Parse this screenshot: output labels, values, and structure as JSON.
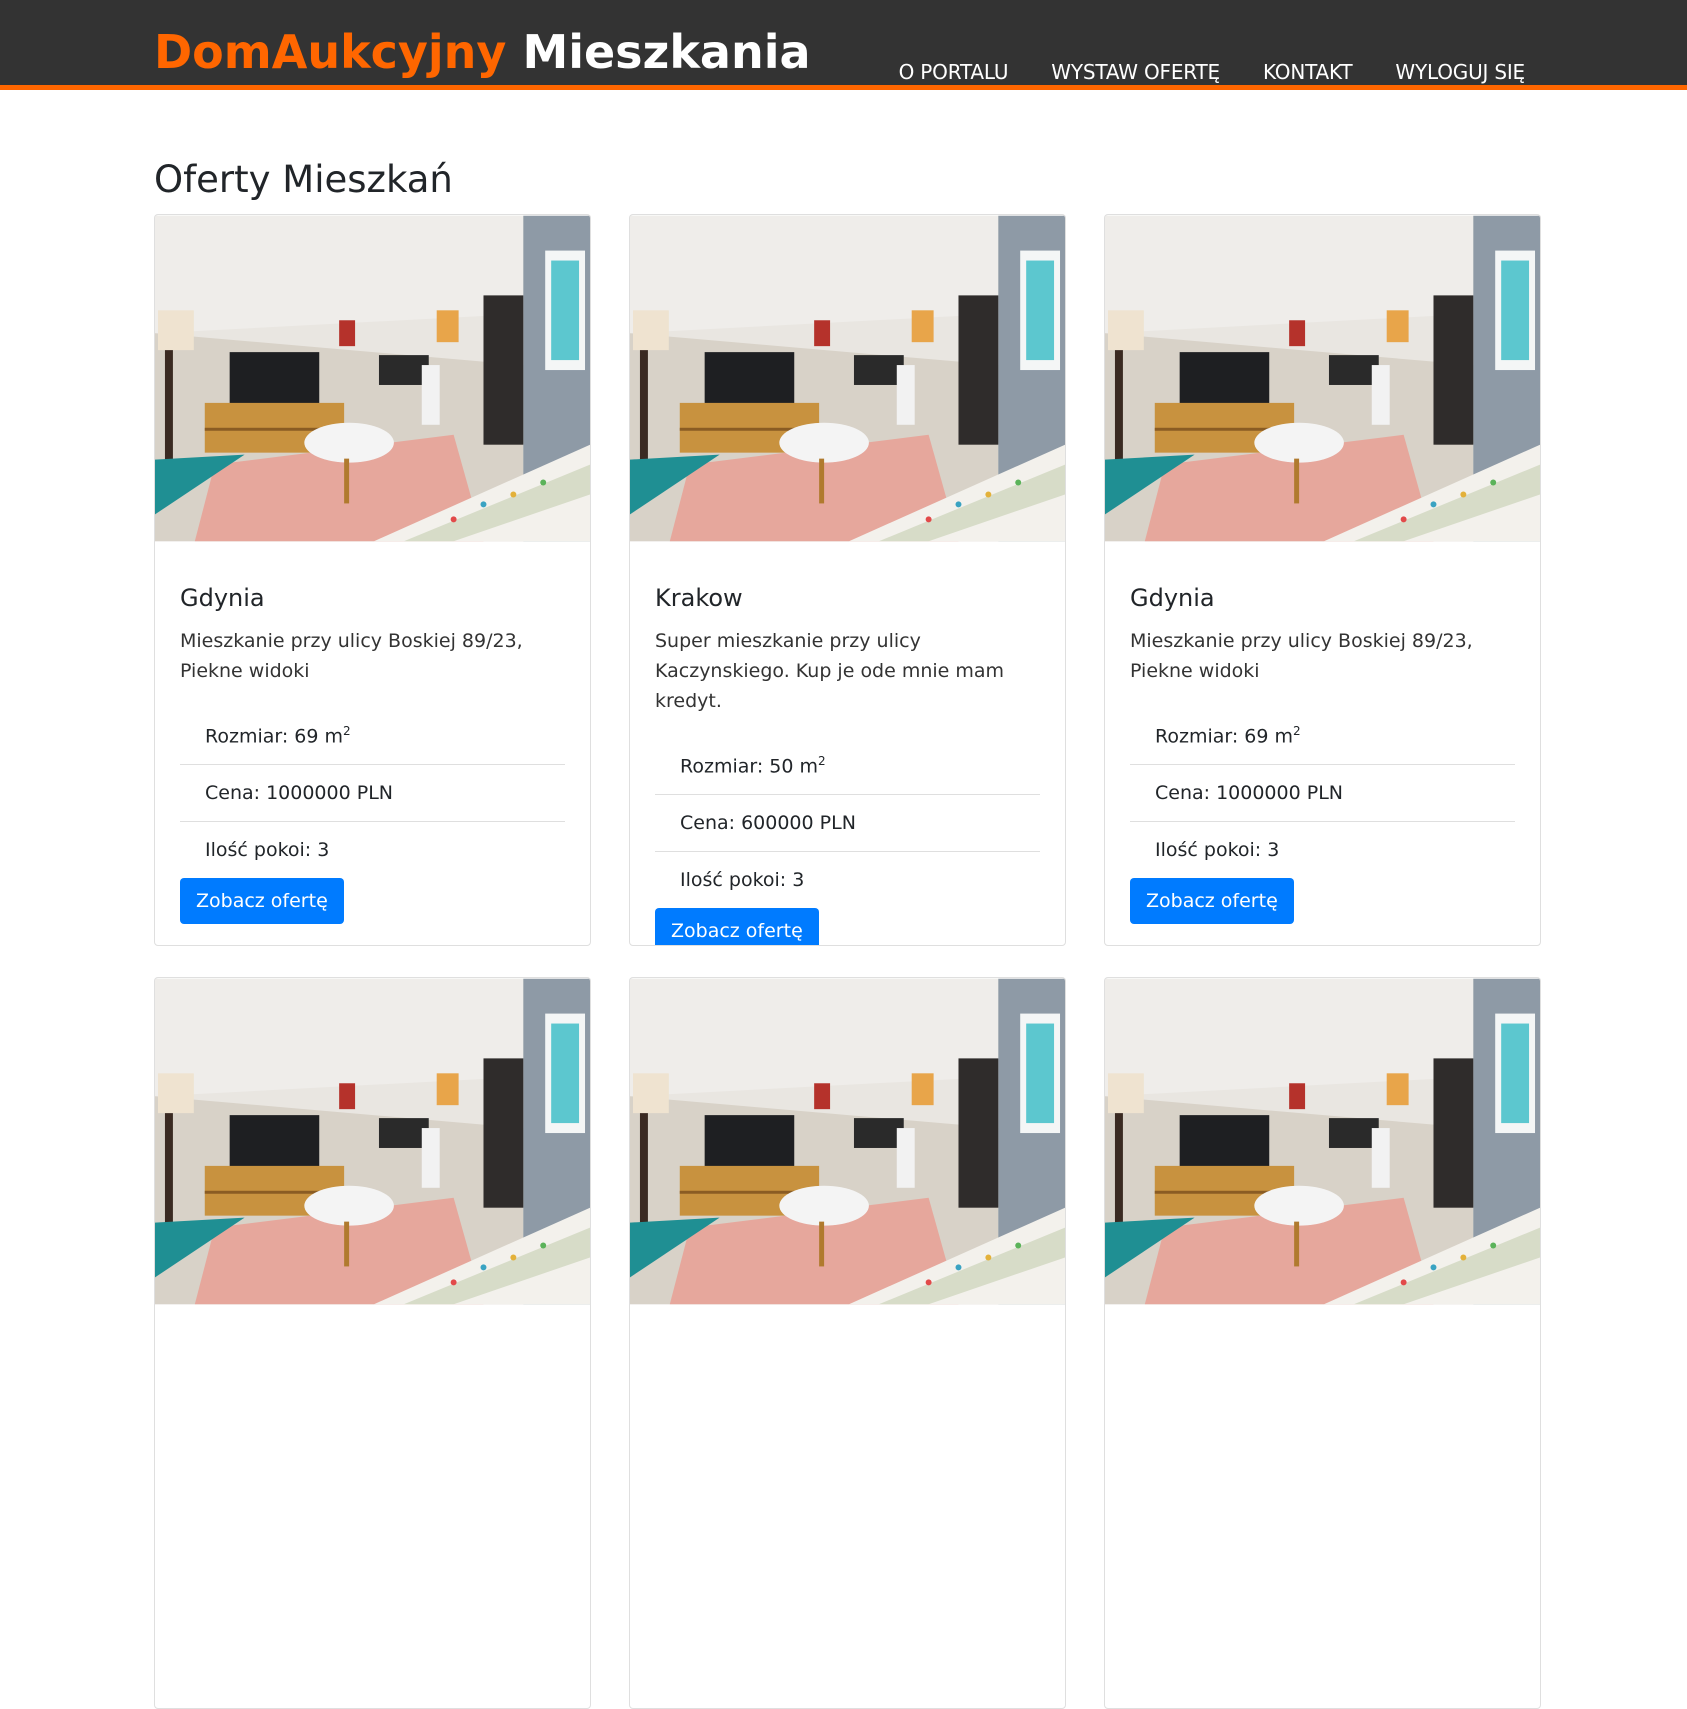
{
  "brand": {
    "part1": "DomAukcyjny",
    "part2": "Mieszkania",
    "accent_color": "#ff6600"
  },
  "nav": [
    {
      "label": "O PORTALU"
    },
    {
      "label": "WYSTAW OFERTĘ"
    },
    {
      "label": "KONTAKT"
    },
    {
      "label": "WYLOGUJ SIĘ"
    }
  ],
  "page_title": "Oferty Mieszkań",
  "labels": {
    "size": "Rozmiar:",
    "price": "Cena:",
    "rooms": "Ilość pokoi:",
    "unit": "m",
    "currency": "PLN",
    "button": "Zobacz ofertę"
  },
  "offers": [
    {
      "city": "Gdynia",
      "description": "Mieszkanie przy ulicy Boskiej 89/23, Piekne widoki",
      "size": "Rozmiar: 69 m",
      "price": "Cena: 1000000 PLN",
      "rooms": "Ilość pokoi: 3",
      "button": "Zobacz ofertę"
    },
    {
      "city": "Krakow",
      "description": "Super mieszkanie przy ulicy Kaczynskiego. Kup je ode mnie mam kredyt.",
      "size": "Rozmiar: 50 m",
      "price": "Cena: 600000 PLN",
      "rooms": "Ilość pokoi: 3",
      "button": "Zobacz ofertę"
    },
    {
      "city": "Gdynia",
      "description": "Mieszkanie przy ulicy Boskiej 89/23, Piekne widoki",
      "size": "Rozmiar: 69 m",
      "price": "Cena: 1000000 PLN",
      "rooms": "Ilość pokoi: 3",
      "button": "Zobacz ofertę"
    }
  ],
  "colors": {
    "navbar": "#333333",
    "button": "#007bff"
  }
}
